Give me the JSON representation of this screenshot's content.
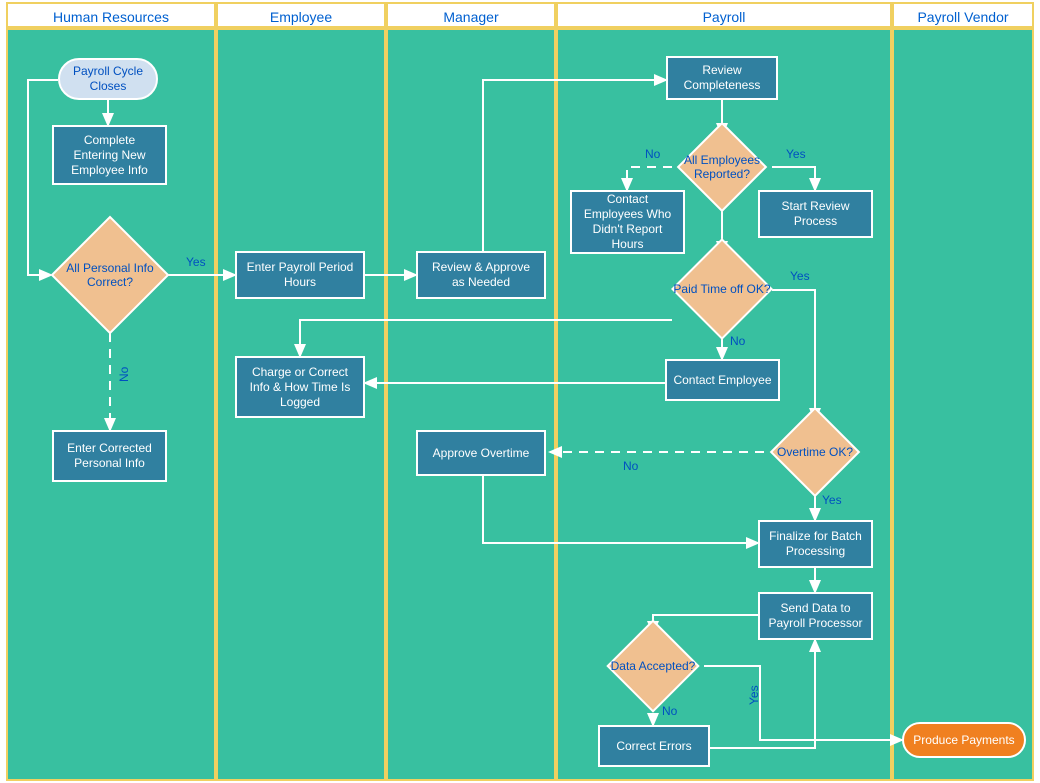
{
  "lanes": {
    "hr": {
      "title": "Human Resources"
    },
    "emp": {
      "title": "Employee"
    },
    "mgr": {
      "title": "Manager"
    },
    "pay": {
      "title": "Payroll"
    },
    "vend": {
      "title": "Payroll Vendor"
    }
  },
  "nodes": {
    "start": "Payroll Cycle Closes",
    "complete_info": "Complete Entering New Employee Info",
    "all_info_correct": "All Personal Info Correct?",
    "enter_corrected_info": "Enter Corrected Personal Info",
    "enter_hours": "Enter Payroll Period Hours",
    "review_approve": "Review & Approve as Needed",
    "charge_correct": "Charge or Correct Info & How Time Is Logged",
    "review_completeness": "Review Completeness",
    "all_employees": "All Employees Reported?",
    "contact_not_reported": "Contact Employees Who Didn't Report Hours",
    "start_review": "Start Review Process",
    "paid_time_off": "Paid Time off OK?",
    "contact_employee": "Contact Employee",
    "overtime_ok": "Overtime OK?",
    "approve_overtime": "Approve Overtime",
    "finalize": "Finalize for Batch Processing",
    "send_data": "Send Data to Payroll Processor",
    "data_accepted": "Data Accepted?",
    "correct_errors": "Correct Errors",
    "produce_payments": "Produce Payments"
  },
  "labels": {
    "yes": "Yes",
    "no": "No"
  }
}
